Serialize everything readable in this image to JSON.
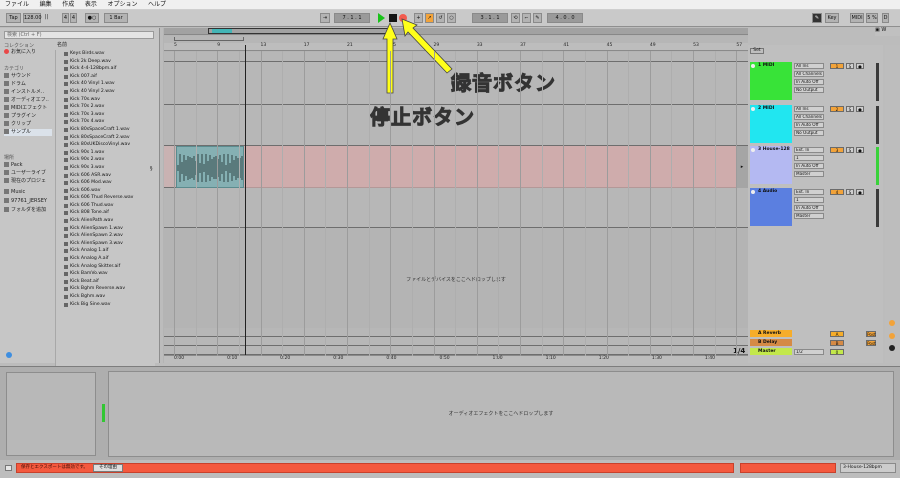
{
  "menu": [
    "ファイル",
    "編集",
    "作成",
    "表示",
    "オプション",
    "ヘルプ"
  ],
  "control": {
    "tap": "Tap",
    "tempo": "128.00",
    "sig_num": "4",
    "sig_den": "4",
    "quant": "1 Bar",
    "pos": "7 . 1 . 1",
    "loop_pos": "3 . 1 . 1",
    "loop_len": "4 . 0 . 0",
    "key": "Key",
    "midi": "MIDI",
    "cpu": "5 %",
    "d": "D"
  },
  "browser": {
    "search_placeholder": "検索 (Ctrl + F)",
    "collections_label": "コレクション",
    "favorites": "お気に入り",
    "category_label": "カテゴリ",
    "categories": [
      "サウンド",
      "ドラム",
      "インストルメ..",
      "オーディオエフ..",
      "MIDIエフェクト",
      "プラグイン",
      "クリップ",
      "サンプル"
    ],
    "places_label": "場所",
    "places": [
      "Pack",
      "ユーザーライブ",
      "現在のプロジェ",
      "Music",
      "97761_JERSEY",
      "フォルダを追加"
    ],
    "name_header": "名前",
    "files": [
      "Keys Birds.wav",
      "Kick 2k Deep.wav",
      "Kick 4-4-128bpm.aif",
      "Kick 007.aif",
      "Kick 40 Vinyl 1.wav",
      "Kick 40 Vinyl 2.wav",
      "Kick 70s.wav",
      "Kick 70s 2.wav",
      "Kick 70s 3.wav",
      "Kick 70s 4.wav",
      "Kick 80sSpaceCraft 1.wav",
      "Kick 80sSpaceCraft 2.wav",
      "Kick 80sUKDiscoVinyl.wav",
      "Kick 90s 1.wav",
      "Kick 90s 2.wav",
      "Kick 90s 3.wav",
      "Kick 606 ASR.wav",
      "Kick 606 Mod.wav",
      "Kick 606.wav",
      "Kick 606 Thud Reverse.wav",
      "Kick 606 Thud.wav",
      "Kick 808 Tone.aif",
      "Kick AlienPath.wav",
      "Kick AlienSpawn 1.wav",
      "Kick AlienSpawn 2.wav",
      "Kick AlienSpawn 3.wav",
      "Kick Analog 1.aif",
      "Kick Analog A.aif",
      "Kick Analog Skitter.aif",
      "Kick BamVo.wav",
      "Kick Beat.aif",
      "Kick Bghm Reverse.wav",
      "Kick Bghm.wav",
      "Kick Big Sine.wav"
    ]
  },
  "arrangement": {
    "ruler": [
      "5",
      "",
      "9",
      "",
      "13",
      "",
      "17",
      "",
      "21",
      "",
      "25",
      "",
      "29",
      "",
      "33",
      "",
      "37",
      "",
      "41",
      "",
      "45",
      "",
      "49",
      "",
      "53",
      "",
      "57"
    ],
    "timeline": [
      "0:00",
      "0:10",
      "0:20",
      "0:30",
      "0:40",
      "0:50",
      "1:00",
      "1:10",
      "1:20",
      "1:30",
      "1:40"
    ],
    "drop_hint": "ファイルとデバイスをここへドロップします",
    "zoom": "1/4"
  },
  "tracks": [
    {
      "name": "1 MIDI",
      "color": "#38e338",
      "in": "All Ins",
      "ch": "All Channels",
      "mon": "In Auto Off",
      "out": "No Output",
      "num": "1"
    },
    {
      "name": "2 MIDI",
      "color": "#21e6f0",
      "in": "All Ins",
      "ch": "All Channels",
      "mon": "In Auto Off",
      "out": "No Output",
      "num": "2"
    },
    {
      "name": "3 House-128",
      "color": "#b4b9f2",
      "in": "Ext. In",
      "ch": "1",
      "mon": "In Auto Off",
      "out": "Master",
      "num": "3"
    },
    {
      "name": "4 Audio",
      "color": "#5b7fe0",
      "in": "Ext. In",
      "ch": "1",
      "mon": "In Auto Off",
      "out": "Master",
      "num": "4"
    }
  ],
  "returns": [
    {
      "name": "A Reverb",
      "color": "#f6ad2a",
      "letter": "A"
    },
    {
      "name": "B Delay",
      "color": "#d58a45",
      "letter": "B"
    },
    {
      "name": "Master",
      "color": "#c3e84b",
      "letter": "0",
      "out": "1/2"
    }
  ],
  "track_header": {
    "set": "Set",
    "post": "Post"
  },
  "detail": {
    "drop_hint": "オーディオエフェクトをここへドロップします"
  },
  "status": {
    "message": "保存とエクスポートは無効です。",
    "button": "その理由",
    "right": "3-House-128bpm"
  },
  "annotations": {
    "record": "録音ボタン",
    "stop": "停止ボタン"
  },
  "colors": {
    "annotation": "#ffff1a",
    "status_bar": "#f4593e",
    "play": "#19c219",
    "record": "#f25b4e"
  }
}
